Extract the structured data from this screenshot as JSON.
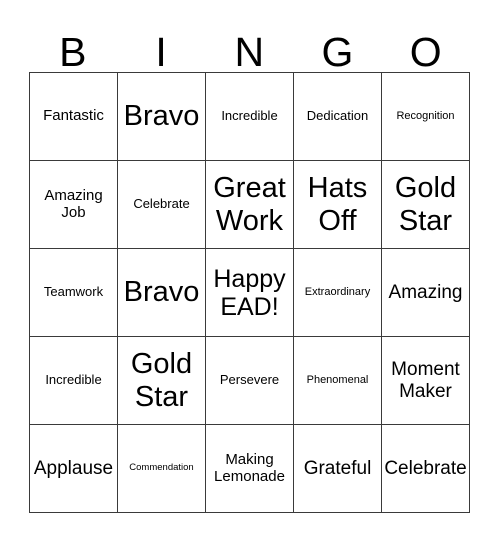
{
  "header": {
    "letters": [
      "B",
      "I",
      "N",
      "G",
      "O"
    ]
  },
  "grid": {
    "rows": 5,
    "columns": 5,
    "border_color": "#3a3a3a",
    "background_color": "#ffffff",
    "text_color": "#000000",
    "cells": [
      [
        {
          "text": "Fantastic",
          "size": "sm"
        },
        {
          "text": "Bravo",
          "size": "xl"
        },
        {
          "text": "Incredible",
          "size": "xs"
        },
        {
          "text": "Dedication",
          "size": "xs"
        },
        {
          "text": "Recognition",
          "size": "xxs"
        }
      ],
      [
        {
          "text": "Amazing Job",
          "size": "sm"
        },
        {
          "text": "Celebrate",
          "size": "xs"
        },
        {
          "text": "Great Work",
          "size": "xl"
        },
        {
          "text": "Hats Off",
          "size": "xl"
        },
        {
          "text": "Gold Star",
          "size": "xl"
        }
      ],
      [
        {
          "text": "Teamwork",
          "size": "xs"
        },
        {
          "text": "Bravo",
          "size": "xl"
        },
        {
          "text": "Happy EAD!",
          "size": "lg"
        },
        {
          "text": "Extraordinary",
          "size": "xxs"
        },
        {
          "text": "Amazing",
          "size": "md"
        }
      ],
      [
        {
          "text": "Incredible",
          "size": "xs"
        },
        {
          "text": "Gold Star",
          "size": "xl"
        },
        {
          "text": "Persevere",
          "size": "xs"
        },
        {
          "text": "Phenomenal",
          "size": "xxs"
        },
        {
          "text": "Moment Maker",
          "size": "md"
        }
      ],
      [
        {
          "text": "Applause",
          "size": "md"
        },
        {
          "text": "Commendation",
          "size": "tiny"
        },
        {
          "text": "Making Lemonade",
          "size": "sm"
        },
        {
          "text": "Grateful",
          "size": "md"
        },
        {
          "text": "Celebrate",
          "size": "md"
        }
      ]
    ]
  }
}
